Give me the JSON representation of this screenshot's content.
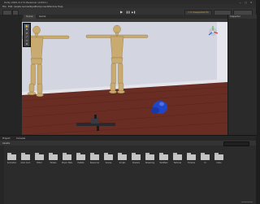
{
  "window": {
    "title": "Unity 2021.3.2 f1 Personal <DX11>",
    "controls": "— ▢ ✕"
  },
  "menu": [
    "File",
    "Edit",
    "Assets",
    "GameObject",
    "Component",
    "Window",
    "Help"
  ],
  "toolbar": {
    "account_label": "⚠ 0 Unexpected Ch",
    "play_icons": [
      "▶",
      "❚❚",
      "▶❚"
    ]
  },
  "scene": {
    "tabs": [
      "Scene",
      "Game"
    ],
    "tools": [
      "✋",
      "✥",
      "⟳",
      "⤢",
      "▭",
      "⊕"
    ]
  },
  "inspector": {
    "tab": "Inspector"
  },
  "project": {
    "tabs": [
      "Project",
      "Console"
    ],
    "breadcrumb": "Assets",
    "folders": [
      "Animation",
      "Anim Cont.",
      "Editor",
      "Models",
      "Physic Mats",
      "Prefabs",
      "Resources",
      "Scenes",
      "Scripts",
      "Shaders",
      "Streaming",
      "TextMesh",
      "Textures",
      "Timeline",
      "UI",
      "Video"
    ]
  },
  "colors": {
    "sky": "#c9cbd8",
    "wall": "#dfe0e8",
    "floor": "#6e3025",
    "mannequin": "#c8aa6e",
    "sphere": "#2447c8"
  }
}
